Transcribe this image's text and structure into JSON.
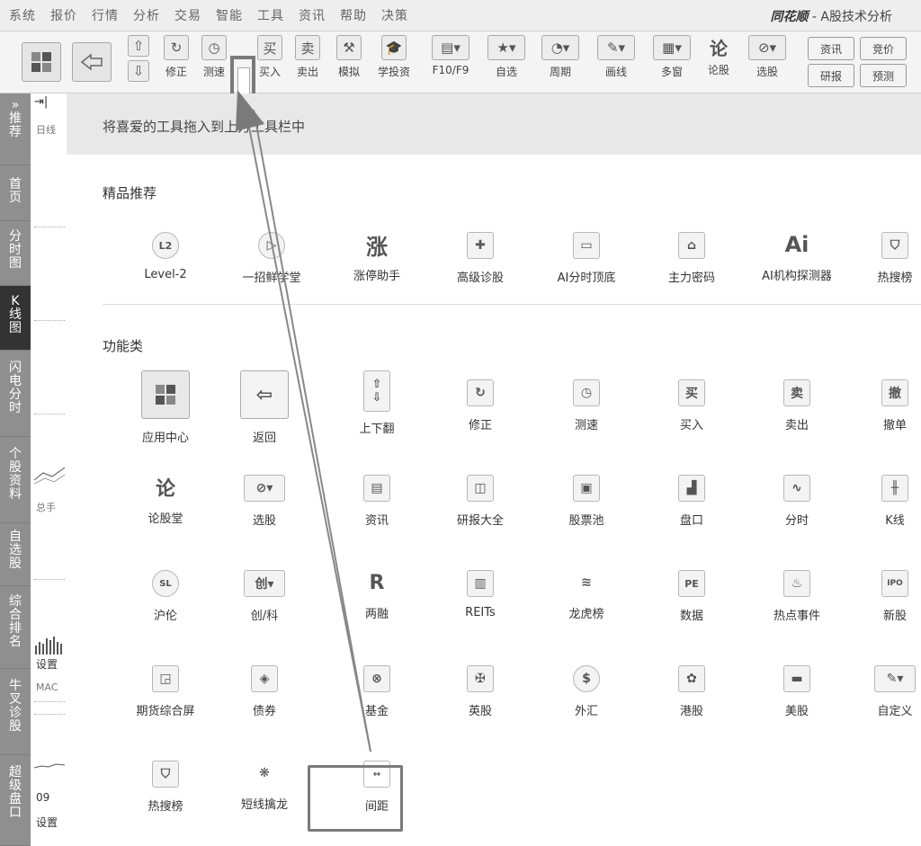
{
  "menubar": {
    "items": [
      "系统",
      "报价",
      "行情",
      "分析",
      "交易",
      "智能",
      "工具",
      "资讯",
      "帮助",
      "决策"
    ],
    "brand_logo": "同花顺",
    "brand_suffix": " - A股技术分析"
  },
  "toolbar": {
    "items": [
      {
        "label": "修正",
        "icon": "refresh-icon"
      },
      {
        "label": "测速",
        "icon": "clock-icon"
      },
      {
        "label": "买入",
        "icon": "buy-icon"
      },
      {
        "label": "卖出",
        "icon": "sell-icon"
      },
      {
        "label": "模拟",
        "icon": "gavel-icon"
      },
      {
        "label": "学投资",
        "icon": "graduation-cap-icon"
      },
      {
        "label": "F10/F9",
        "icon": "f10-icon"
      },
      {
        "label": "自选",
        "icon": "star-icon"
      },
      {
        "label": "周期",
        "icon": "cycle-icon"
      },
      {
        "label": "画线",
        "icon": "pen-icon"
      },
      {
        "label": "多窗",
        "icon": "multi-window-icon"
      },
      {
        "label": "论股",
        "icon": "discuss-icon"
      },
      {
        "label": "选股",
        "icon": "screener-icon"
      }
    ],
    "small_buttons": [
      "资讯",
      "竞价",
      "研报",
      "预测"
    ]
  },
  "sidebar": {
    "items": [
      "推荐",
      "首页",
      "分时图",
      "K线图",
      "闪电分时",
      "个股资料",
      "自选股",
      "综合排名",
      "牛叉诊股",
      "超级盘口"
    ],
    "active": "K线图"
  },
  "chart_strip": {
    "labels": [
      "日线",
      "总手",
      "设置",
      "MAC",
      "09",
      "设置"
    ]
  },
  "panel": {
    "header": "将喜爱的工具拖入到上方工具栏中",
    "premium_title": "精品推荐",
    "premium": [
      {
        "label": "Level-2",
        "icon": "L2"
      },
      {
        "label": "一招鲜学堂",
        "icon": "play-icon"
      },
      {
        "label": "涨停助手",
        "icon": "涨"
      },
      {
        "label": "高级诊股",
        "icon": "medkit-icon"
      },
      {
        "label": "AI分时顶底",
        "icon": "monitor-icon"
      },
      {
        "label": "主力密码",
        "icon": "lock-icon"
      },
      {
        "label": "AI机构探测器",
        "icon": "Ai"
      },
      {
        "label": "热搜榜",
        "icon": "shield-icon"
      }
    ],
    "functions_title": "功能类",
    "functions": [
      {
        "label": "应用中心",
        "icon": "app-grid-icon"
      },
      {
        "label": "返回",
        "icon": "back-arrow-icon"
      },
      {
        "label": "上下翻",
        "icon": "up-down-icon"
      },
      {
        "label": "修正",
        "icon": "refresh-icon"
      },
      {
        "label": "测速",
        "icon": "clock-icon"
      },
      {
        "label": "买入",
        "icon": "买"
      },
      {
        "label": "卖出",
        "icon": "卖"
      },
      {
        "label": "撤单",
        "icon": "撤"
      },
      {
        "label": "论股堂",
        "icon": "论"
      },
      {
        "label": "选股",
        "icon": "screener-icon"
      },
      {
        "label": "资讯",
        "icon": "document-icon"
      },
      {
        "label": "研报大全",
        "icon": "book-icon"
      },
      {
        "label": "股票池",
        "icon": "chart-icon"
      },
      {
        "label": "盘口",
        "icon": "market-icon"
      },
      {
        "label": "分时",
        "icon": "timeshare-icon"
      },
      {
        "label": "K线",
        "icon": "candlestick-icon"
      },
      {
        "label": "沪伦",
        "icon": "sl-icon"
      },
      {
        "label": "创/科",
        "icon": "创"
      },
      {
        "label": "两融",
        "icon": "R"
      },
      {
        "label": "REITs",
        "icon": "building-icon"
      },
      {
        "label": "龙虎榜",
        "icon": "dragon-icon"
      },
      {
        "label": "数据",
        "icon": "PE"
      },
      {
        "label": "热点事件",
        "icon": "hot-icon"
      },
      {
        "label": "新股",
        "icon": "IPO"
      },
      {
        "label": "期货综合屏",
        "icon": "futures-icon"
      },
      {
        "label": "债券",
        "icon": "bond-icon"
      },
      {
        "label": "基金",
        "icon": "fund-icon"
      },
      {
        "label": "英股",
        "icon": "uk-flag-icon"
      },
      {
        "label": "外汇",
        "icon": "dollar-icon"
      },
      {
        "label": "港股",
        "icon": "hk-flag-icon"
      },
      {
        "label": "美股",
        "icon": "us-flag-icon"
      },
      {
        "label": "自定义",
        "icon": "custom-icon"
      },
      {
        "label": "热搜榜",
        "icon": "shield-icon"
      },
      {
        "label": "短线擒龙",
        "icon": "dragon-catch-icon"
      },
      {
        "label": "间距",
        "icon": "spacing-icon"
      }
    ]
  },
  "colors": {
    "sidebar": "#8f8f8f",
    "active_tab": "#333333",
    "panel_header": "#e8e8e8",
    "highlight": "#7a7a7a"
  }
}
